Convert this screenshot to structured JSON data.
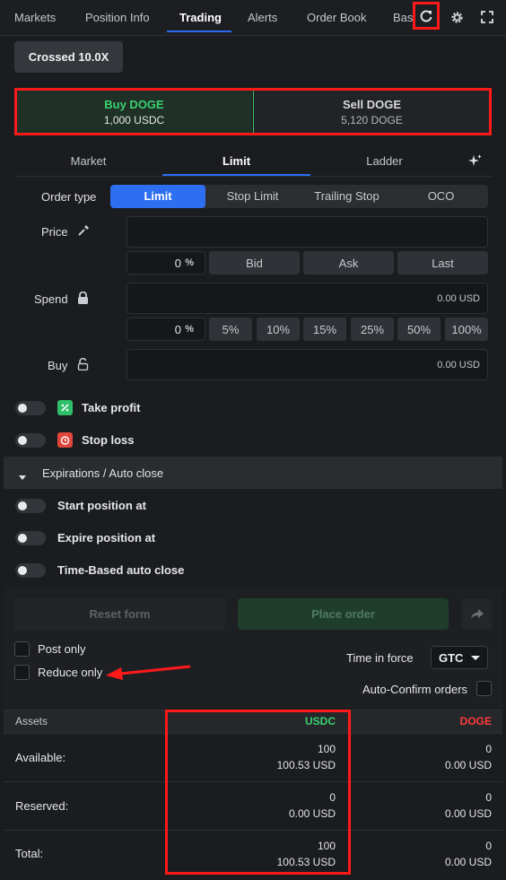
{
  "top_tabs": [
    "Markets",
    "Position Info",
    "Trading",
    "Alerts",
    "Order Book",
    "Bas"
  ],
  "margin_mode_label": "Crossed 10.0X",
  "buy": {
    "title": "Buy DOGE",
    "amount": "1,000 USDC"
  },
  "sell": {
    "title": "Sell DOGE",
    "amount": "5,120 DOGE"
  },
  "order_tabs": [
    "Market",
    "Limit",
    "Ladder"
  ],
  "order_type": {
    "label": "Order type",
    "options": [
      "Limit",
      "Stop Limit",
      "Trailing Stop",
      "OCO"
    ],
    "selected": "Limit"
  },
  "price": {
    "label": "Price",
    "value": "",
    "percent": "0",
    "percent_sign": "%",
    "chips": [
      "Bid",
      "Ask",
      "Last"
    ]
  },
  "spend": {
    "label": "Spend",
    "value": "0.00 USD",
    "percent": "0",
    "percent_sign": "%",
    "chips": [
      "5%",
      "10%",
      "15%",
      "25%",
      "50%",
      "100%"
    ]
  },
  "buy_field": {
    "label": "Buy",
    "value": "0.00 USD"
  },
  "options": {
    "take_profit": "Take profit",
    "stop_loss": "Stop loss"
  },
  "expirations": {
    "header": "Expirations / Auto close",
    "items": [
      "Start position at",
      "Expire position at",
      "Time-Based auto close"
    ]
  },
  "actions": {
    "reset": "Reset form",
    "place": "Place order"
  },
  "checks": {
    "post_only": "Post only",
    "reduce_only": "Reduce only"
  },
  "time_in_force": {
    "label": "Time in force",
    "value": "GTC"
  },
  "auto_confirm": "Auto-Confirm orders",
  "assets": {
    "header": "Assets",
    "col_usdc": "USDC",
    "col_doge": "DOGE",
    "rows": [
      {
        "label": "Available:",
        "usdc_main": "100",
        "usdc_sub": "100.53 USD",
        "doge_main": "0",
        "doge_sub": "0.00 USD"
      },
      {
        "label": "Reserved:",
        "usdc_main": "0",
        "usdc_sub": "0.00 USD",
        "doge_main": "0",
        "doge_sub": "0.00 USD"
      },
      {
        "label": "Total:",
        "usdc_main": "100",
        "usdc_sub": "100.53 USD",
        "doge_main": "0",
        "doge_sub": "0.00 USD"
      }
    ]
  },
  "colors": {
    "accent": "#2d6ff0",
    "buy_green": "#3bd16f",
    "sell_red": "#ff3b3b",
    "highlight_red": "#ff1a1a"
  },
  "icons": [
    "refresh-icon",
    "gear-icon",
    "fullscreen-icon",
    "sparkle-icon",
    "eyedropper-icon",
    "lock-icon",
    "unlock-icon",
    "take-profit-icon",
    "stop-loss-icon",
    "caret-down-icon",
    "share-icon",
    "chevron-down-icon"
  ]
}
